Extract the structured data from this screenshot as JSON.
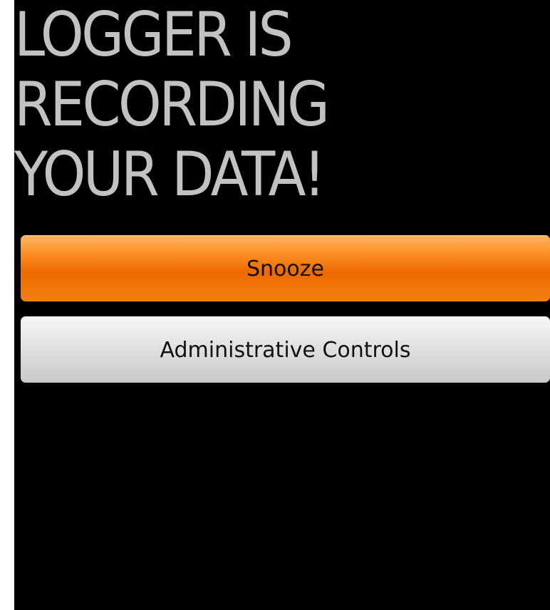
{
  "headline": {
    "text": "LOGGER IS\nRECORDING\nYOUR DATA!"
  },
  "buttons": {
    "snooze_label": "Snooze",
    "admin_label": "Administrative Controls"
  },
  "colors": {
    "background": "#000000",
    "headline_text": "#c2c2c2",
    "snooze_accent": "#ee6a00",
    "admin_button": "#d8d8d8",
    "button_text": "#111111"
  }
}
